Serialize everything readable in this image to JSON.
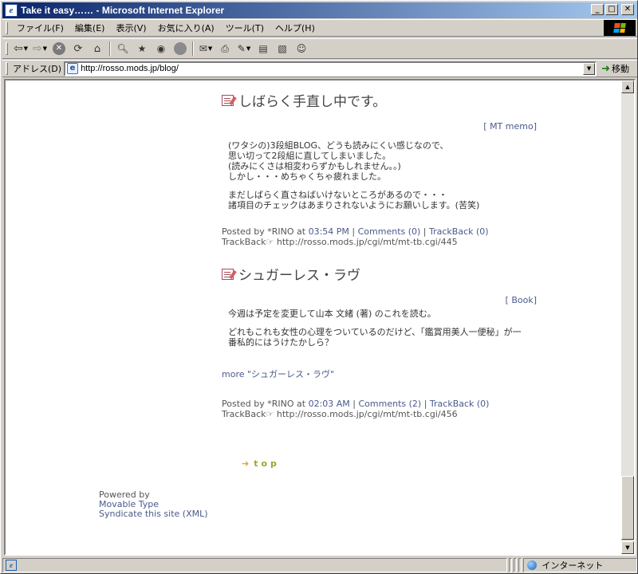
{
  "window": {
    "title": "Take it easy…… - Microsoft Internet Explorer",
    "minimize_glyph": "_",
    "maximize_glyph": "□",
    "close_glyph": "✕"
  },
  "menu": {
    "items": [
      "ファイル(F)",
      "編集(E)",
      "表示(V)",
      "お気に入り(A)",
      "ツール(T)",
      "ヘルプ(H)"
    ]
  },
  "toolbar": {
    "buttons": [
      "back-icon",
      "forward-icon",
      "stop-icon",
      "refresh-icon",
      "home-icon",
      "search-icon",
      "favorites-icon",
      "media-icon",
      "history-icon",
      "mail-icon",
      "print-icon",
      "edit-icon",
      "discuss-icon",
      "research-icon",
      "messenger-icon"
    ]
  },
  "address": {
    "label": "アドレス(D)",
    "url": "http://rosso.mods.jp/blog/",
    "go_label": "移動"
  },
  "posts": [
    {
      "title": "しばらく手直し中です。",
      "category": "[ MT memo]",
      "paragraphs": [
        "(ワタシの)3段組BLOG、どうも読みにくい感じなので、\n思い切って2段組に直してしまいました。\n(読みにくさは相変わらずかもしれません。。)\nしかし・・・めちゃくちゃ疲れました。",
        "まだしばらく直さねばいけないところがあるので・・・\n諸項目のチェックはあまりされないようにお願いします。(苦笑)"
      ],
      "posted_by": "Posted by *RINO at",
      "time": "03:54 PM",
      "comments": "Comments (0)",
      "trackback": "TrackBack (0)",
      "trackback_label": "TrackBack☞",
      "trackback_url": "http://rosso.mods.jp/cgi/mt/mt-tb.cgi/445"
    },
    {
      "title": "シュガーレス・ラヴ",
      "category": "[ Book]",
      "paragraphs": [
        "今週は予定を変更して山本 文緒 (著) のこれを読む。",
        "どれもこれも女性の心理をついているのだけど、「鑑賞用美人一便秘」が一\n番私的にはうけたかしら？"
      ],
      "more": "more \"シュガーレス・ラヴ\"",
      "posted_by": "Posted by *RINO at",
      "time": "02:03 AM",
      "comments": "Comments (2)",
      "trackback": "TrackBack (0)",
      "trackback_label": "TrackBack☞",
      "trackback_url": "http://rosso.mods.jp/cgi/mt/mt-tb.cgi/456"
    }
  ],
  "top_link": "top",
  "footer": {
    "powered_by": "Powered by",
    "movable_type": "Movable Type",
    "syndicate": "Syndicate this site (XML)"
  },
  "status": {
    "zone": "インターネット"
  }
}
